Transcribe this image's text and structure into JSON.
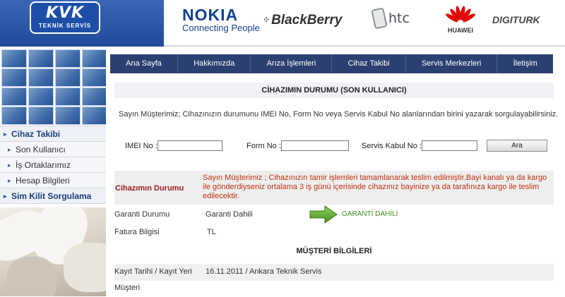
{
  "header": {
    "logo_big": "KVK",
    "logo_small": "TEKNİK SERVİS",
    "brands": {
      "nokia_name": "NOKIA",
      "nokia_tagline": "Connecting People",
      "blackberry": "BlackBerry",
      "htc": "htc",
      "huawei": "HUAWEI",
      "digiturk": "DIGITURK"
    }
  },
  "sidebar": {
    "items": [
      {
        "label": "Cihaz Takibi"
      },
      {
        "label": "Son Kullanıcı"
      },
      {
        "label": "İş Ortaklarımız"
      },
      {
        "label": "Hesap Bilgileri"
      },
      {
        "label": "Sim Kilit Sorgulama"
      }
    ]
  },
  "nav": {
    "items": [
      "Ana Sayfa",
      "Hakkımızda",
      "Arıza İşlemleri",
      "Cihaz Takibi",
      "Servis Merkezleri",
      "İletişim"
    ]
  },
  "main": {
    "title": "CİHAZIMIN DURUMU (SON KULLANICI)",
    "info": "Sayın Müşterimiz; Cihazınızın durumunu IMEI No, Form No veya Servis Kabul No alanlarından birini yazarak sorgulayabilirsiniz.",
    "form": {
      "imei_label": "IMEI No :",
      "form_label": "Form No :",
      "servis_label": "Servis Kabul No :",
      "imei_value": "",
      "form_value": "",
      "servis_value": "",
      "button": "Ara"
    },
    "status": {
      "label": "Cihazımın Durumu",
      "message": "Sayın Müşterimiz ; Cihazınızın tamir işlemleri tamamlanarak teslim edilmiştir.Bayi kanalı ya da kargo ile gönderdiyseniz ortalama 3 iş günü içerisinde cihazınız bayinize ya da tarafınıza kargo ile teslim edilecektir."
    },
    "garanti": {
      "label": "Garanti Durumu",
      "value": "Garanti Dahili",
      "badge": "GARANTİ DAHİLİ",
      "arrow_color": "#5aa02c"
    },
    "fatura": {
      "label": "Fatura Bilgisi",
      "value": "TL"
    },
    "customer_title": "MÜŞTERİ BİLGİLERİ",
    "kayit": {
      "label": "Kayıt Tarihi / Kayıt Yeri",
      "value": "16.11.2011 / Ankara Teknik Servis"
    },
    "musteri": {
      "label": "Müşteri"
    }
  },
  "colors": {
    "header_blue": "#214a99",
    "nav_bg": "#2b3f70",
    "status_red": "#c13010",
    "garanti_green": "#3f8a1f"
  }
}
